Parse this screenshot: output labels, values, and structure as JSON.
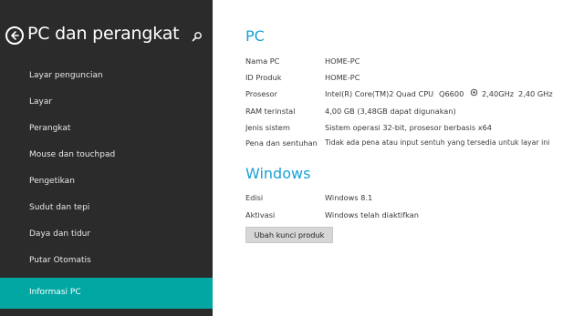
{
  "sidebar": {
    "title": "PC dan perangkat",
    "items": [
      {
        "label": "Layar penguncian"
      },
      {
        "label": "Layar"
      },
      {
        "label": "Perangkat"
      },
      {
        "label": "Mouse dan touchpad"
      },
      {
        "label": "Pengetikan"
      },
      {
        "label": "Sudut dan tepi"
      },
      {
        "label": "Daya dan tidur"
      },
      {
        "label": "Putar Otomatis"
      },
      {
        "label": "Informasi PC",
        "active": true
      }
    ]
  },
  "pc": {
    "heading": "PC",
    "rows": [
      {
        "label": "Nama PC",
        "value": "HOME-PC"
      },
      {
        "label": "ID Produk",
        "value": "HOME-PC"
      },
      {
        "label": "Prosesor",
        "value": "Intel(R) Core(TM)2 Quad CPU",
        "extra1": "Q6600",
        "extra2": "2,40GHz",
        "extra3": "2,40 GHz"
      },
      {
        "label": "RAM terinstal",
        "value": "4,00 GB (3,48GB dapat digunakan)"
      },
      {
        "label": "Jenis sistem",
        "value": "Sistem operasi 32-bit, prosesor berbasis x64"
      },
      {
        "label": "Pena dan sentuhan",
        "value": "Tidak ada pena atau input sentuh yang tersedia untuk layar ini"
      }
    ]
  },
  "windows": {
    "heading": "Windows",
    "rows": [
      {
        "label": "Edisi",
        "value": "Windows 8.1"
      },
      {
        "label": "Aktivasi",
        "value": "Windows telah diaktifkan"
      }
    ],
    "button_label": "Ubah kunci produk"
  },
  "colors": {
    "sidebar_bg": "#2b2b2b",
    "accent": "#00a7a3",
    "heading": "#1aa0d8"
  },
  "icons": {
    "back": "back-arrow-icon",
    "search": "search-icon"
  }
}
